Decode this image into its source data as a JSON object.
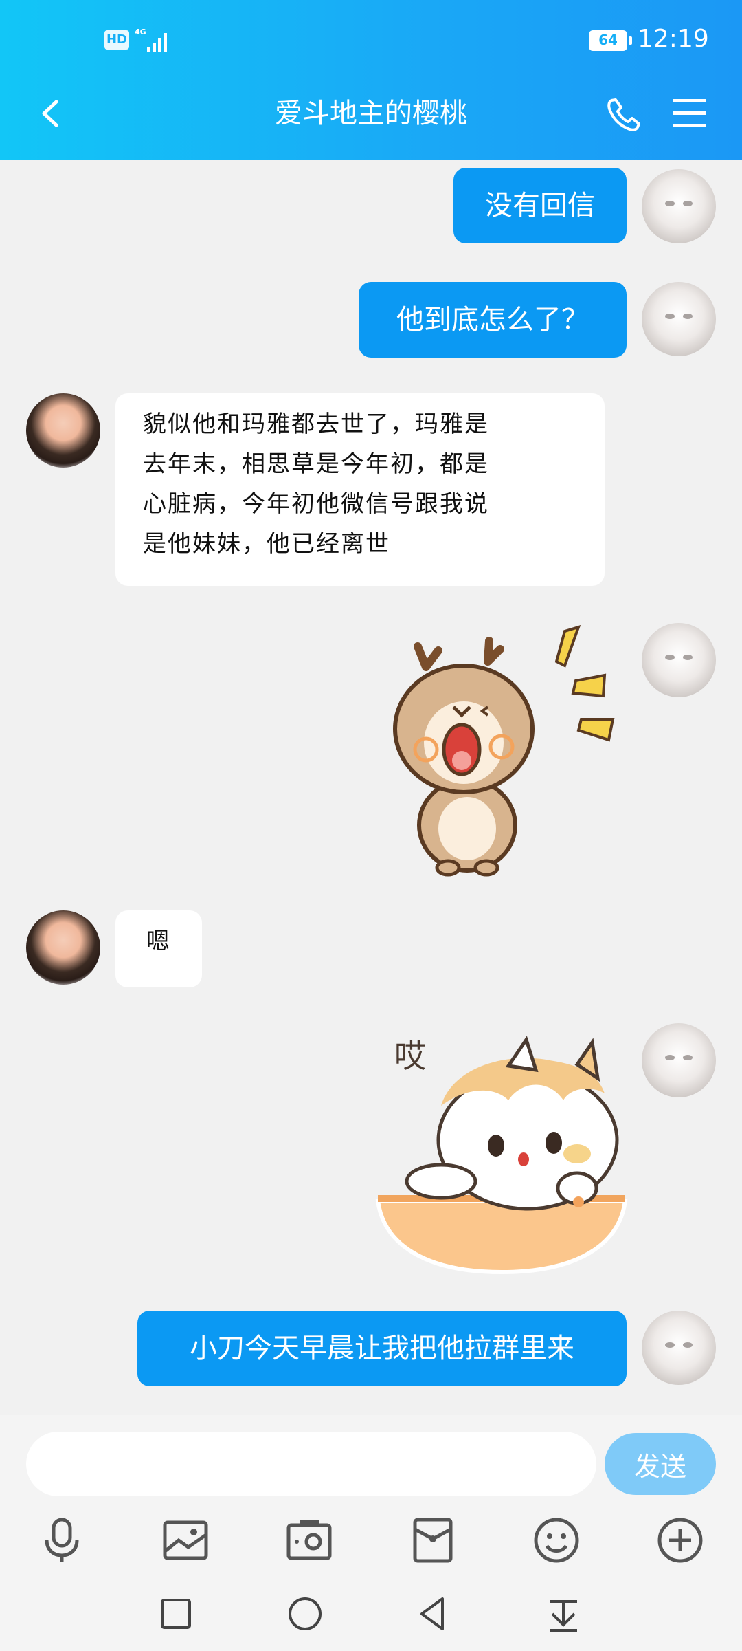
{
  "status_bar": {
    "hd": "HD",
    "network": "4G",
    "battery": "64",
    "time": "12:19"
  },
  "header": {
    "title": "爱斗地主的樱桃"
  },
  "messages": [
    {
      "side": "out",
      "type": "text",
      "text": "没有回信"
    },
    {
      "side": "out",
      "type": "text",
      "text": "他到底怎么了？"
    },
    {
      "side": "in",
      "type": "text",
      "lines": [
        "貌似他和玛雅都去世了，玛雅是",
        "去年末，相思草是今年初，都是",
        "心脏病，今年初他微信号跟我说",
        "是他妹妹，他已经离世"
      ]
    },
    {
      "side": "out",
      "type": "sticker",
      "sticker": "shocked-deer-sticker"
    },
    {
      "side": "in",
      "type": "text",
      "text": "嗯"
    },
    {
      "side": "out",
      "type": "sticker",
      "sticker": "sighing-cat-sticker",
      "caption": "哎"
    },
    {
      "side": "out",
      "type": "text",
      "text": "小刀今天早晨让我把他拉群里来"
    }
  ],
  "input": {
    "value": "",
    "send_label": "发送"
  },
  "toolbar": [
    "microphone-icon",
    "image-icon",
    "camera-icon",
    "red-packet-icon",
    "emoji-icon",
    "plus-icon"
  ],
  "colors": {
    "header_start": "#12c6f7",
    "header_end": "#1b98f5",
    "bubble_out": "#0b99f3",
    "send_button": "#7fcaf8"
  }
}
